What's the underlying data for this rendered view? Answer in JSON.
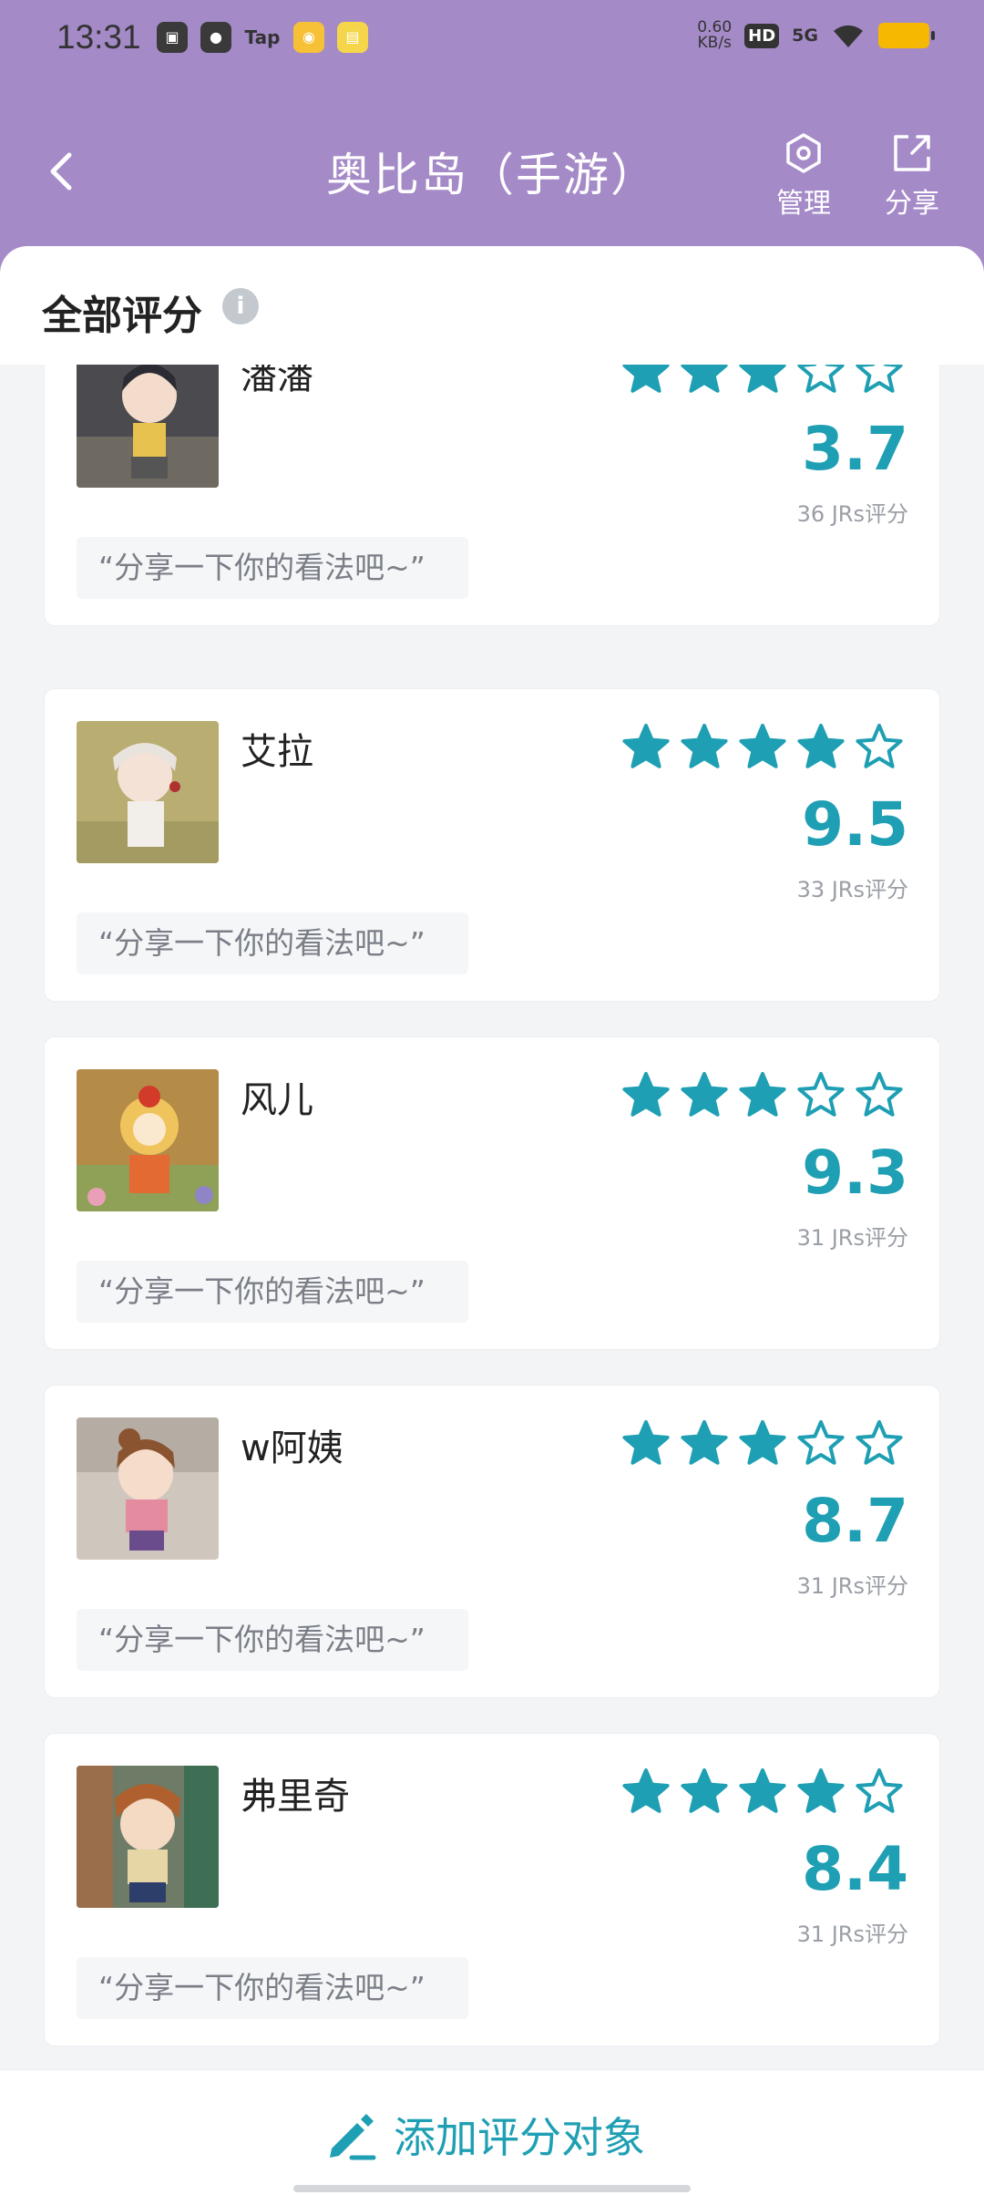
{
  "status_bar": {
    "time": "13:31",
    "net_speed_value": "0.60",
    "net_speed_unit": "KB/s",
    "hd": "HD",
    "signal": "5G",
    "notif_tap": "Tap"
  },
  "nav": {
    "title": "奥比岛（手游）",
    "manage_label": "管理",
    "share_label": "分享"
  },
  "section": {
    "title": "全部评分",
    "info_glyph": "i"
  },
  "theme": {
    "header_bg": "#a58ac8",
    "accent": "#1e9fb3"
  },
  "cards": [
    {
      "name": "潘潘",
      "stars": 3,
      "score": "3.7",
      "count": "36 JRs评分",
      "comment": "“分享一下你的看法吧~”"
    },
    {
      "name": "艾拉",
      "stars": 4,
      "score": "9.5",
      "count": "33 JRs评分",
      "comment": "“分享一下你的看法吧~”"
    },
    {
      "name": "风儿",
      "stars": 3,
      "score": "9.3",
      "count": "31 JRs评分",
      "comment": "“分享一下你的看法吧~”"
    },
    {
      "name": "w阿姨",
      "stars": 3,
      "score": "8.7",
      "count": "31 JRs评分",
      "comment": "“分享一下你的看法吧~”"
    },
    {
      "name": "弗里奇",
      "stars": 4,
      "score": "8.4",
      "count": "31 JRs评分",
      "comment": "“分享一下你的看法吧~”"
    }
  ],
  "bottom": {
    "add_label": "添加评分对象"
  }
}
